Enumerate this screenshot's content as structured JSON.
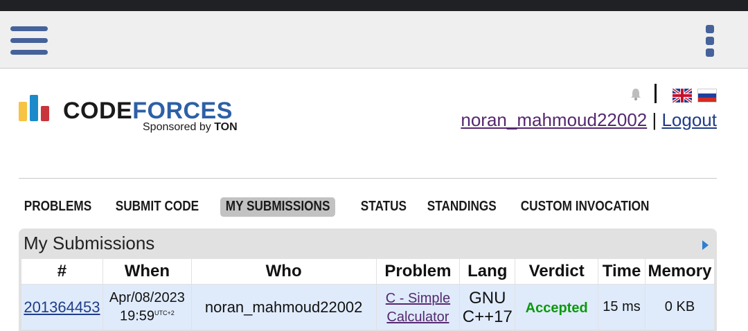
{
  "header": {
    "menu_icon": "hamburger-menu-icon",
    "more_icon": "vertical-dots-icon"
  },
  "logo": {
    "title_part1": "CODE",
    "title_part2": "FORCES",
    "sponsor_prefix": "Sponsored by ",
    "sponsor_name": "TON",
    "colors": {
      "yellow": "#f6c343",
      "blue": "#1b8acb",
      "red": "#c9353c"
    }
  },
  "user": {
    "handle": "noran_mahmoud22002",
    "separator": " | ",
    "logout_label": "Logout"
  },
  "menu": {
    "items": [
      {
        "label": "PROBLEMS"
      },
      {
        "label": "SUBMIT CODE"
      },
      {
        "label": "MY SUBMISSIONS",
        "active": true
      },
      {
        "label": "STATUS"
      },
      {
        "label": "STANDINGS"
      },
      {
        "label": "CUSTOM INVOCATION"
      }
    ]
  },
  "submissions": {
    "title": "My Submissions",
    "columns": [
      "#",
      "When",
      "Who",
      "Problem",
      "Lang",
      "Verdict",
      "Time",
      "Memory"
    ],
    "rows": [
      {
        "id": "201364453",
        "date": "Apr/08/2023",
        "time": "19:59",
        "tz": "UTC+2",
        "who": "noran_mahmoud22002",
        "problem_line1": "C - Simple",
        "problem_line2": "Calculator",
        "lang_line1": "GNU",
        "lang_line2": "C++17",
        "verdict": "Accepted",
        "exec_time": "15 ms",
        "memory": "0 KB"
      }
    ]
  },
  "colors": {
    "accent": "#45629a",
    "accepted": "#0a9a0a",
    "link": "#1f3c88",
    "visited_link": "#55286f",
    "row_bg": "#dfebfb"
  }
}
